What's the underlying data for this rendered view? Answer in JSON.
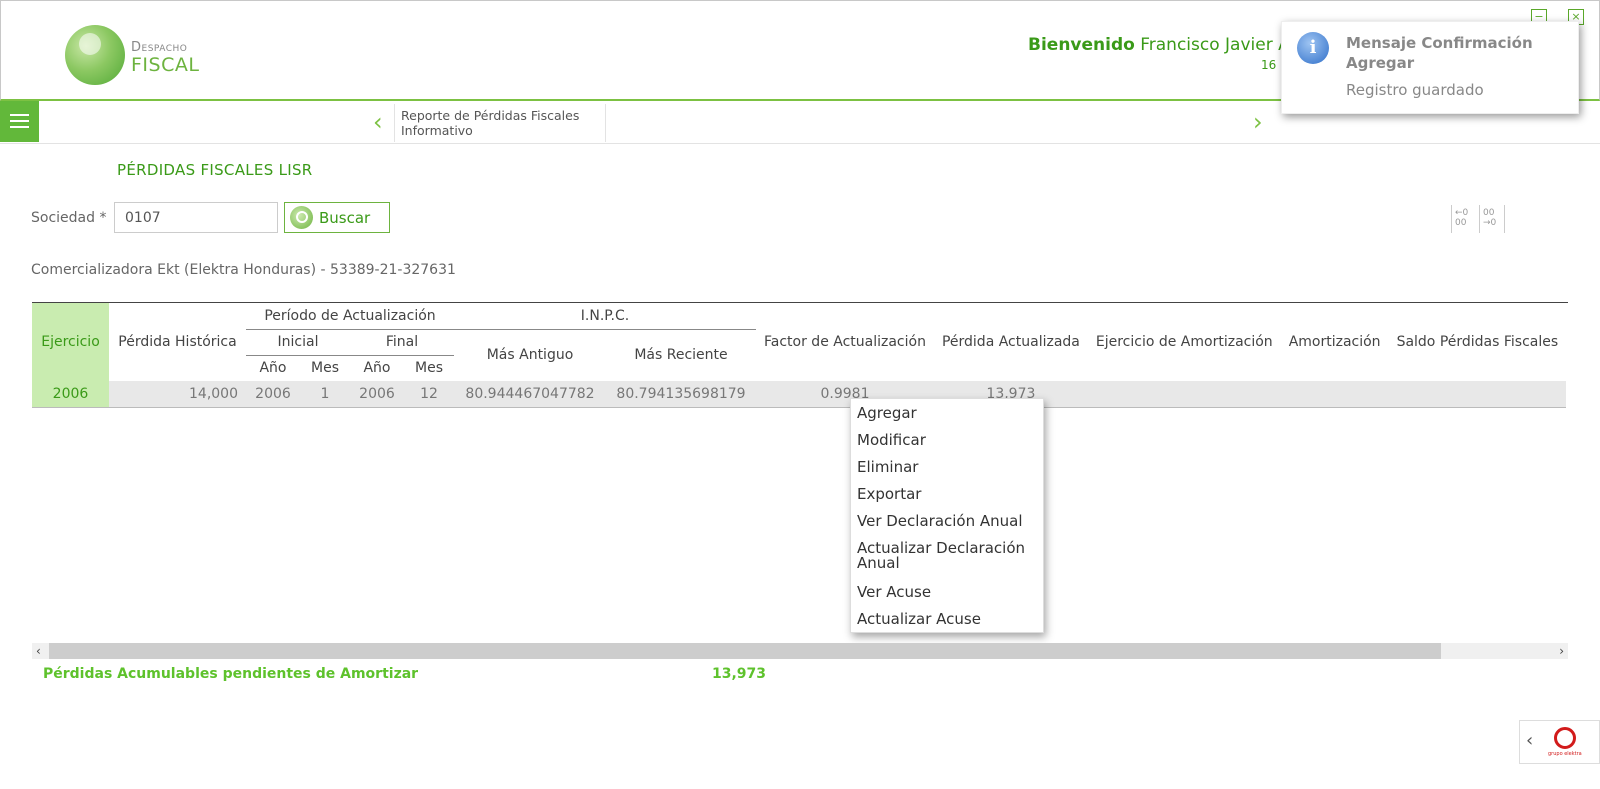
{
  "header": {
    "logo_top": "Despacho",
    "logo_bottom": "FISCAL",
    "welcome_label": "Bienvenido",
    "user_name": "Francisco Javier A",
    "date_partial": "16",
    "minimize_label": "−",
    "close_label": "×"
  },
  "notification": {
    "title": "Mensaje Confirmación Agregar",
    "body": "Registro guardado",
    "icon": "info-icon",
    "icon_glyph": "i"
  },
  "navbar": {
    "tab_label": "Reporte de Pérdidas Fiscales Informativo",
    "prev_arrow": "‹",
    "next_arrow": "›"
  },
  "page": {
    "title": "PÉRDIDAS FISCALES LISR",
    "sociedad_label": "Sociedad *",
    "sociedad_value": "0107",
    "search_label": "Buscar",
    "company_info": "Comercializadora Ekt (Elektra Honduras) - 53389-21-327631",
    "col_ctrl_left": "←0 00",
    "col_ctrl_right": "00 →0"
  },
  "table": {
    "headers": {
      "ejercicio": "Ejercicio",
      "perdida_historica": "Pérdida Histórica",
      "periodo": "Período de Actualización",
      "inpc": "I.N.P.C.",
      "inicial": "Inicial",
      "final": "Final",
      "anio1": "Año",
      "mes1": "Mes",
      "anio2": "Año",
      "mes2": "Mes",
      "mas_antiguo": "Más Antiguo",
      "mas_reciente": "Más Reciente",
      "factor": "Factor de Actualización",
      "perdida_actualizada": "Pérdida Actualizada",
      "ejercicio_amortizacion": "Ejercicio de Amortización",
      "amortizacion": "Amortización",
      "saldo": "Saldo Pérdidas Fiscales"
    },
    "rows": [
      {
        "ejercicio": "2006",
        "perdida_historica": "14,000",
        "anio_inicial": "2006",
        "mes_inicial": "1",
        "anio_final": "2006",
        "mes_final": "12",
        "mas_antiguo": "80.944467047782",
        "mas_reciente": "80.794135698179",
        "factor": "0.9981",
        "perdida_actualizada": "13,973",
        "ejercicio_amortizacion": "",
        "amortizacion": "",
        "saldo": ""
      }
    ]
  },
  "context_menu": {
    "items": [
      "Agregar",
      "Modificar",
      "Eliminar",
      "Exportar",
      "Ver Declaración Anual",
      "Actualizar Declaración Anual",
      "Ver Acuse",
      "Actualizar Acuse"
    ]
  },
  "totals": {
    "label": "Pérdidas Acumulables pendientes de Amortizar",
    "value": "13,973"
  },
  "scroll": {
    "left_arrow": "‹",
    "right_arrow": "›"
  },
  "footer_badge": {
    "arrow": "‹",
    "logo_text": "grupo elektra"
  },
  "colors": {
    "brand_green": "#6db33f",
    "dark_green": "#3a9a18",
    "highlight_green": "#c9ecb0",
    "total_green": "#5ec22c",
    "info_blue": "#2f6fc9"
  }
}
